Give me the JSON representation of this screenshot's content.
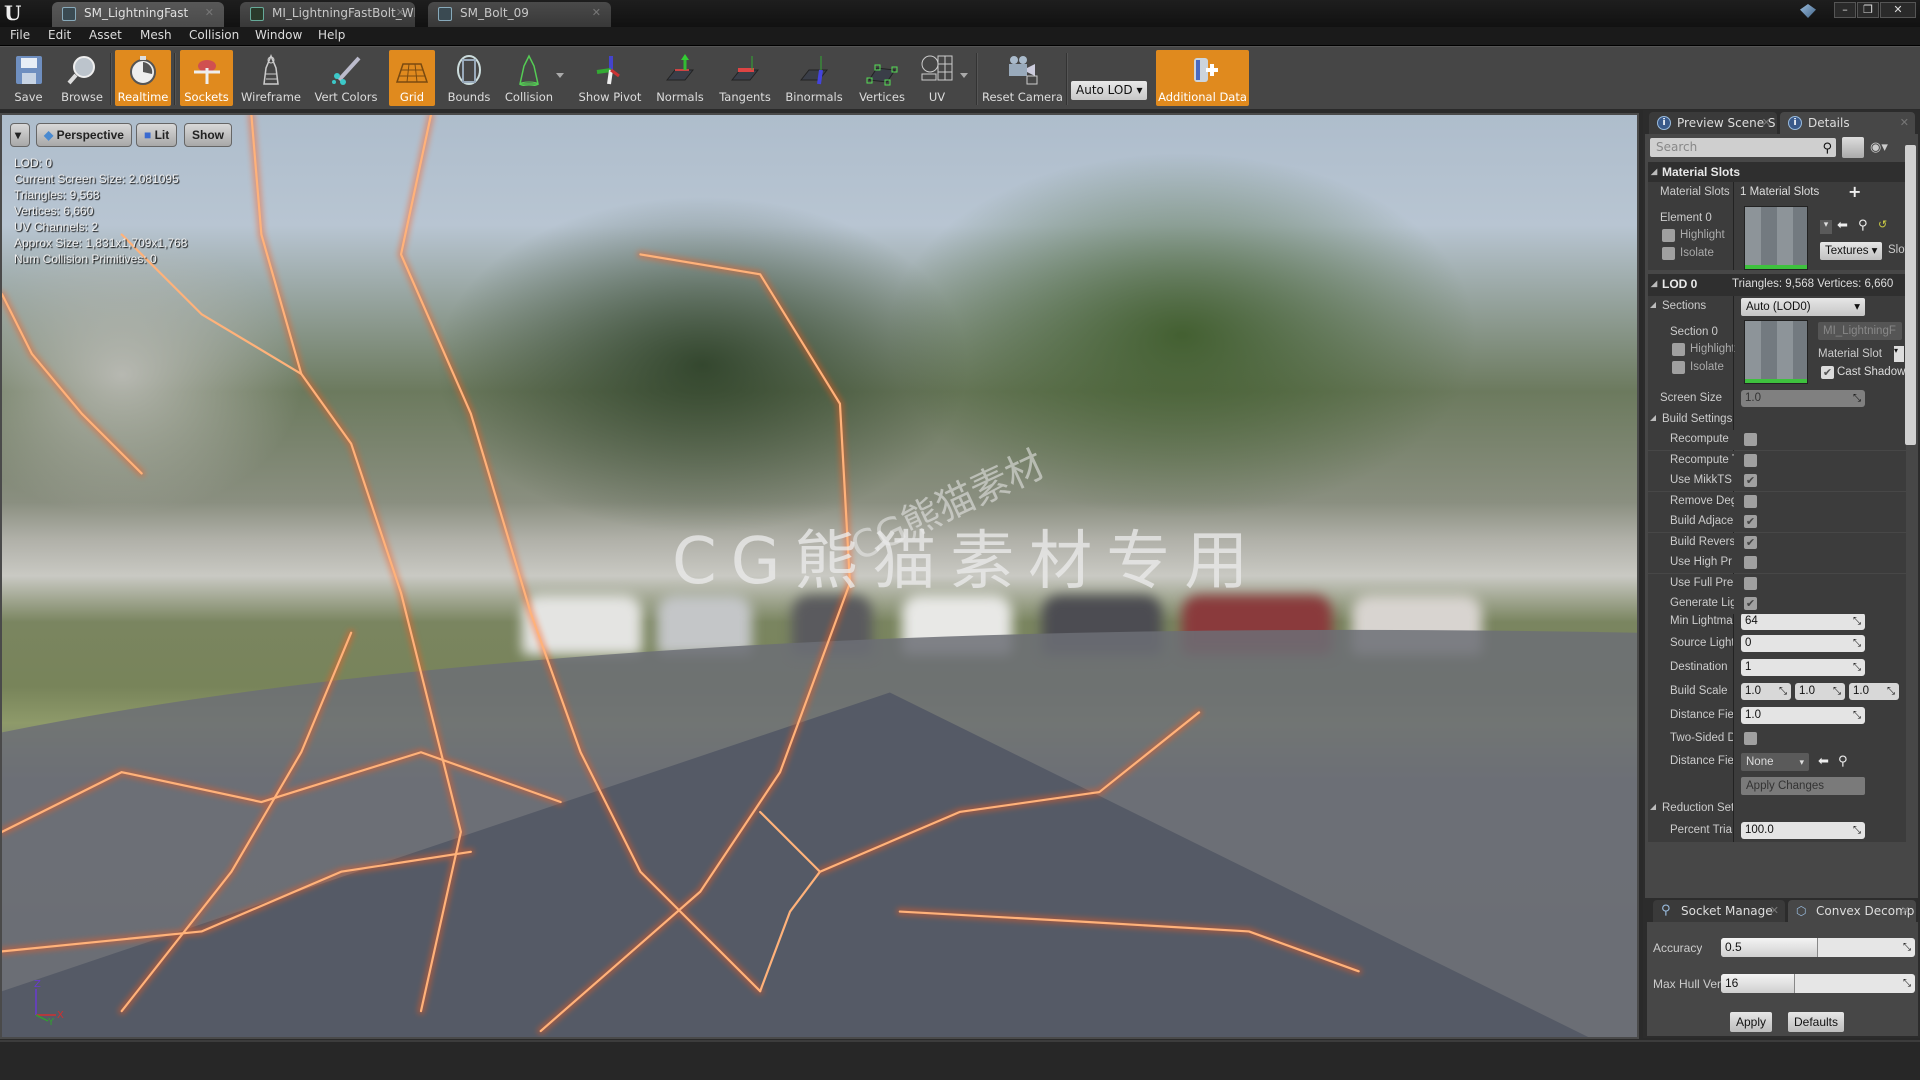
{
  "tabs": [
    {
      "label": "SM_LightningFast",
      "icon": "static-mesh-icon",
      "active": true
    },
    {
      "label": "MI_LightningFastBolt_Wh",
      "icon": "material-instance-icon",
      "active": false
    },
    {
      "label": "SM_Bolt_09",
      "icon": "static-mesh-icon",
      "active": false
    }
  ],
  "window_controls": {
    "minimize": "–",
    "restore": "❐",
    "close": "✕"
  },
  "menu": [
    "File",
    "Edit",
    "Asset",
    "Mesh",
    "Collision",
    "Window",
    "Help"
  ],
  "toolbar": {
    "buttons": [
      {
        "label": "Save",
        "icon": "save-icon",
        "active": false
      },
      {
        "label": "Browse",
        "icon": "browse-icon",
        "active": false
      },
      {
        "label": "Realtime",
        "icon": "realtime-icon",
        "active": true
      },
      {
        "label": "Sockets",
        "icon": "sockets-icon",
        "active": true
      },
      {
        "label": "Wireframe",
        "icon": "wireframe-icon",
        "active": false
      },
      {
        "label": "Vert Colors",
        "icon": "vert-colors-icon",
        "active": false
      },
      {
        "label": "Grid",
        "icon": "grid-icon",
        "active": true
      },
      {
        "label": "Bounds",
        "icon": "bounds-icon",
        "active": false
      },
      {
        "label": "Collision",
        "icon": "collision-icon",
        "active": false
      },
      {
        "label": "Show Pivot",
        "icon": "pivot-icon",
        "active": false
      },
      {
        "label": "Normals",
        "icon": "normals-icon",
        "active": false
      },
      {
        "label": "Tangents",
        "icon": "tangents-icon",
        "active": false
      },
      {
        "label": "Binormals",
        "icon": "binormals-icon",
        "active": false
      },
      {
        "label": "Vertices",
        "icon": "vertices-icon",
        "active": false
      },
      {
        "label": "UV",
        "icon": "uv-icon",
        "active": false
      },
      {
        "label": "Reset Camera",
        "icon": "camera-icon",
        "active": false
      },
      {
        "label": "Additional Data",
        "icon": "additional-data-icon",
        "active": true
      }
    ],
    "lod_select": "Auto LOD"
  },
  "viewport": {
    "options": {
      "perspective": "Perspective",
      "lit": "Lit",
      "show": "Show"
    },
    "hud": [
      "LOD:  0",
      "Current Screen Size:  2.081095",
      "Triangles:  9,568",
      "Vertices:  6,660",
      "UV Channels:  2",
      "Approx Size: 1,831x1,709x1,768",
      "Num Collision Primitives:  0"
    ],
    "watermark": "CG熊猫素材专用",
    "watermark2": "CG熊猫素材",
    "axis": {
      "x": "X",
      "y": "Y",
      "z": "Z"
    }
  },
  "details_panel": {
    "tabs": [
      {
        "label": "Preview Scene S",
        "active": false
      },
      {
        "label": "Details",
        "active": true
      }
    ],
    "search_placeholder": "Search",
    "material_slots": {
      "title": "Material Slots",
      "label": "Material Slots",
      "value": "1 Material Slots",
      "element_label": "Element 0",
      "highlight": "Highlight",
      "isolate": "Isolate",
      "textures_btn": "Textures",
      "slot_name": "Slot N"
    },
    "lod0": {
      "title": "LOD 0",
      "stats": "Triangles: 9,568   Vertices: 6,660",
      "sections_label": "Sections",
      "sections_value": "Auto (LOD0)",
      "section_label": "Section 0",
      "highlight": "Highlight",
      "isolate": "Isolate",
      "material_name": "MI_LightningF",
      "material_slot": "Material Slot",
      "cast_shadow": "Cast Shadow",
      "screen_size_label": "Screen Size",
      "screen_size_value": "1.0"
    },
    "build_settings": {
      "title": "Build Settings",
      "checks": [
        {
          "label": "Recompute",
          "checked": false
        },
        {
          "label": "Recompute T",
          "checked": false
        },
        {
          "label": "Use MikkTS",
          "checked": true
        },
        {
          "label": "Remove Deg",
          "checked": false
        },
        {
          "label": "Build Adjace",
          "checked": true
        },
        {
          "label": "Build Revers",
          "checked": true
        },
        {
          "label": "Use High Pr",
          "checked": false
        },
        {
          "label": "Use Full Pre",
          "checked": false
        },
        {
          "label": "Generate Lig",
          "checked": true
        }
      ],
      "min_lightmap_label": "Min Lightma",
      "min_lightmap_value": "64",
      "source_light_label": "Source Light",
      "source_light_value": "0",
      "destination_label": "Destination",
      "destination_value": "1",
      "build_scale_label": "Build Scale",
      "build_scale_values": [
        "1.0",
        "1.0",
        "1.0"
      ],
      "distance_field_label": "Distance Fie",
      "distance_field_value": "1.0",
      "two_sided_label": "Two-Sided D",
      "two_sided_checked": false,
      "distance_field2_label": "Distance Fie",
      "distance_field2_value": "None",
      "apply_changes": "Apply Changes"
    },
    "reduction": {
      "title": "Reduction Set",
      "percent_label": "Percent Tria",
      "percent_value": "100.0"
    }
  },
  "bottom_panel": {
    "tabs": [
      {
        "label": "Socket Manage",
        "active": false
      },
      {
        "label": "Convex Decomp",
        "active": true
      }
    ],
    "accuracy_label": "Accuracy",
    "accuracy_value": "0.5",
    "accuracy_fraction": 0.5,
    "max_hull_label": "Max Hull Ver",
    "max_hull_value": "16",
    "max_hull_fraction": 0.38,
    "apply": "Apply",
    "defaults": "Defaults"
  },
  "colors": {
    "accent": "#e08a1e",
    "lightning": "#ff7a2a"
  }
}
